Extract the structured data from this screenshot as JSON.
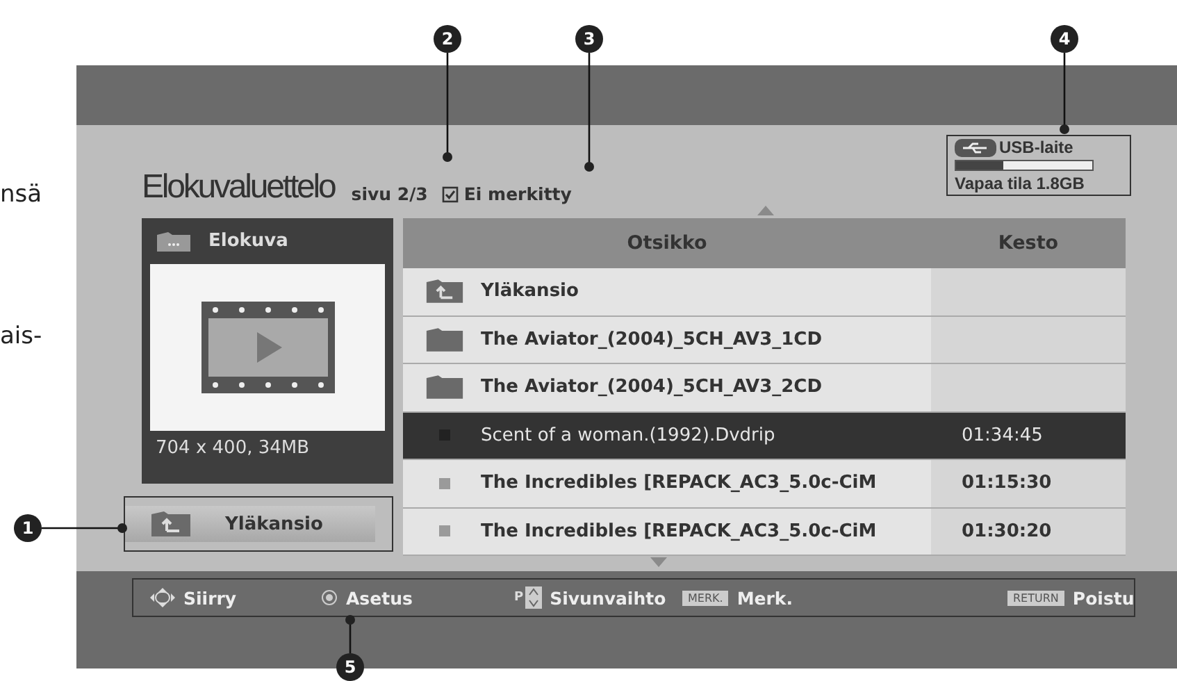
{
  "page_fragments": [
    "nsä",
    "ais-"
  ],
  "screen": {
    "title": "Elokuvaluettelo",
    "page": "sivu 2/3",
    "mark_filter": {
      "label": "Ei merkitty",
      "checked": true
    },
    "usb": {
      "label": "USB-laite",
      "level": 0.35,
      "free": "Vapaa tila 1.8GB"
    },
    "preview": {
      "category": "Elokuva",
      "info": "704 x 400, 34MB"
    },
    "up_button": "Yläkansio",
    "table": {
      "columns": [
        "Otsikko",
        "Kesto"
      ],
      "rows": [
        {
          "kind": "up",
          "title": "Yläkansio",
          "selected": false
        },
        {
          "kind": "folder",
          "title": "The Aviator_(2004)_5CH_AV3_1CD",
          "selected": false
        },
        {
          "kind": "folder",
          "title": "The Aviator_(2004)_5CH_AV3_2CD",
          "selected": false
        },
        {
          "kind": "file",
          "title": "Scent of a woman.(1992).Dvdrip",
          "duration": "01:34:45",
          "selected": true
        },
        {
          "kind": "file",
          "title": "The Incredibles [REPACK_AC3_5.0c-CiM",
          "duration": "01:15:30",
          "selected": false
        },
        {
          "kind": "file",
          "title": "The Incredibles [REPACK_AC3_5.0c-CiM",
          "duration": "01:30:20",
          "selected": false
        }
      ]
    },
    "hints": [
      {
        "kind": "move",
        "label": "Siirry"
      },
      {
        "kind": "ok",
        "label": "Asetus"
      },
      {
        "kind": "page",
        "key": "P",
        "label": "Sivunvaihto"
      },
      {
        "kind": "key",
        "key": "MERK.",
        "label": "Merk."
      },
      {
        "kind": "key",
        "key": "RETURN",
        "label": "Poistu"
      }
    ]
  },
  "callouts": [
    "1",
    "2",
    "3",
    "4",
    "5"
  ]
}
